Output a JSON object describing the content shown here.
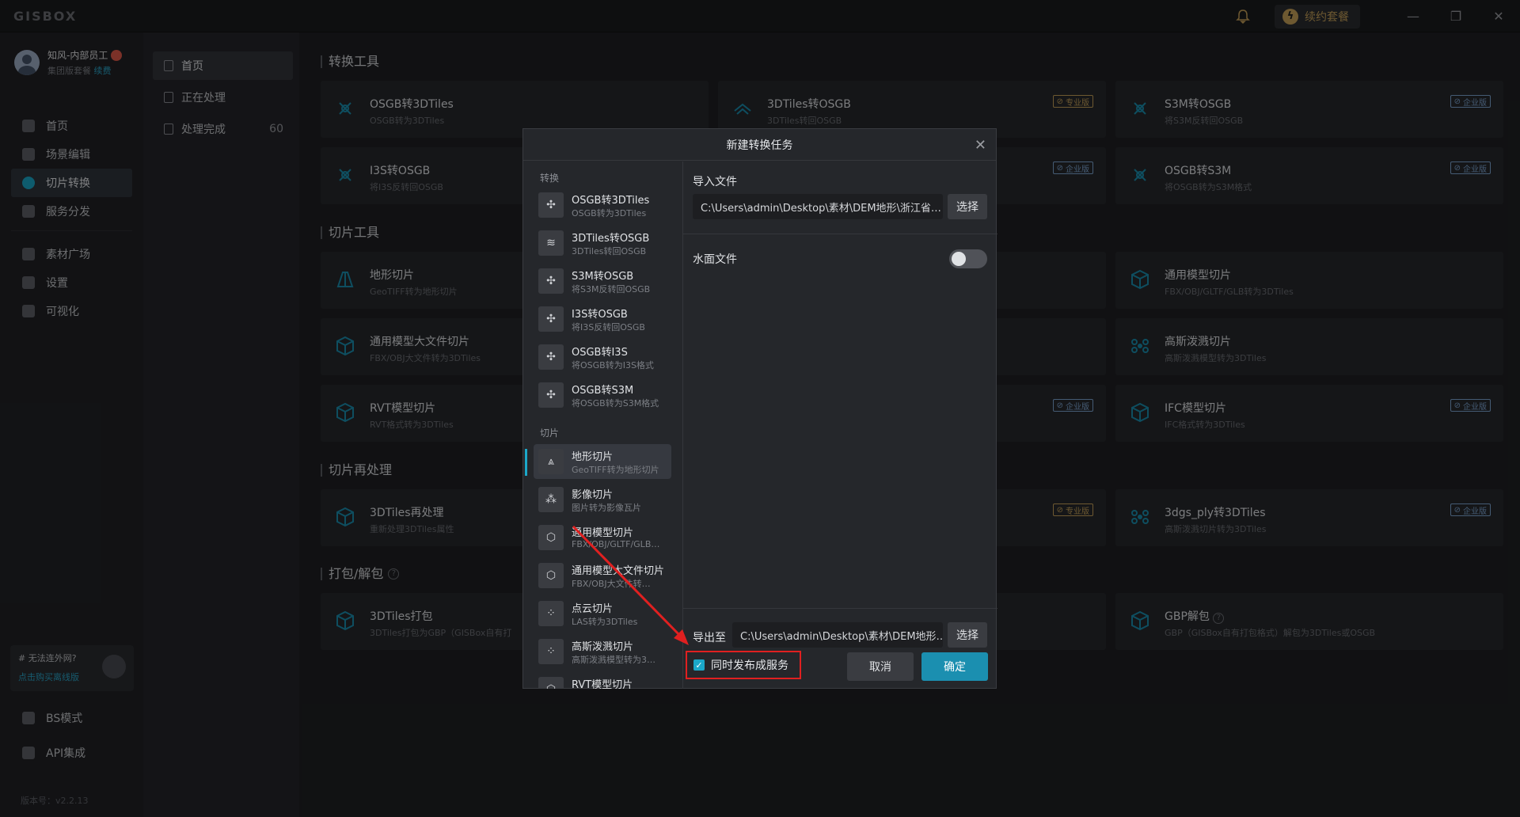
{
  "app": {
    "logo": "GISBOX"
  },
  "titlebar": {
    "renew_label": "续约套餐"
  },
  "user": {
    "name": "知风-内部员工",
    "plan": "集团版套餐",
    "renew_link": "续费"
  },
  "nav": [
    {
      "label": "首页",
      "icon": "home-icon"
    },
    {
      "label": "场景编辑",
      "icon": "cube-icon"
    },
    {
      "label": "切片转换",
      "icon": "convert-icon"
    },
    {
      "label": "服务分发",
      "icon": "upload-icon"
    },
    {
      "label": "素材广场",
      "icon": "chart-icon"
    },
    {
      "label": "设置",
      "icon": "gear-icon"
    },
    {
      "label": "可视化",
      "icon": "visual-icon"
    },
    {
      "label": "BS模式",
      "icon": "code-icon"
    },
    {
      "label": "API集成",
      "icon": "api-icon"
    }
  ],
  "promo": {
    "title": "# 无法连外网?",
    "link": "点击购买离线版"
  },
  "version": "版本号：v2.2.13",
  "subnav": [
    {
      "label": "首页"
    },
    {
      "label": "正在处理"
    },
    {
      "label": "处理完成",
      "count": "60"
    }
  ],
  "sections": {
    "convert": "转换工具",
    "slice": "切片工具",
    "reprocess": "切片再处理",
    "pack": "打包/解包"
  },
  "tags": {
    "pro": "专业版",
    "ent": "企业版"
  },
  "cards": {
    "c1": {
      "title": "OSGB转3DTiles",
      "sub": "OSGB转为3DTiles"
    },
    "c2": {
      "title": "3DTiles转OSGB",
      "sub": "3DTiles转回OSGB"
    },
    "c3": {
      "title": "S3M转OSGB",
      "sub": "将S3M反转回OSGB"
    },
    "c4": {
      "title": "I3S转OSGB",
      "sub": "将I3S反转回OSGB"
    },
    "c6": {
      "title": "OSGB转S3M",
      "sub": "将OSGB转为S3M格式"
    },
    "c7": {
      "title": "地形切片",
      "sub": "GeoTIFF转为地形切片"
    },
    "c9": {
      "title": "通用模型切片",
      "sub": "FBX/OBJ/GLTF/GLB转为3DTiles"
    },
    "c10": {
      "title": "通用模型大文件切片",
      "sub": "FBX/OBJ大文件转为3DTiles"
    },
    "c12": {
      "title": "高斯泼溅切片",
      "sub": "高斯泼溅模型转为3DTiles"
    },
    "c13": {
      "title": "RVT模型切片",
      "sub": "RVT格式转为3DTiles"
    },
    "c15": {
      "title": "IFC模型切片",
      "sub": "IFC格式转为3DTiles"
    },
    "c16": {
      "title": "3DTiles再处理",
      "sub": "重新处理3DTiles属性"
    },
    "c18": {
      "title": "3dgs_ply转3DTiles",
      "sub": "高斯泼溅切片转为3DTiles"
    },
    "c19": {
      "title": "3DTiles打包",
      "sub": "3DTiles打包为GBP（GISBox自有打"
    },
    "c21": {
      "title": "GBP解包",
      "sub": "GBP（GISBox自有打包格式）解包为3DTiles或OSGB"
    }
  },
  "dialog": {
    "title": "新建转换任务",
    "group_convert": "转换",
    "group_slice": "切片",
    "items": [
      {
        "title": "OSGB转3DTiles",
        "sub": "OSGB转为3DTiles"
      },
      {
        "title": "3DTiles转OSGB",
        "sub": "3DTiles转回OSGB"
      },
      {
        "title": "S3M转OSGB",
        "sub": "将S3M反转回OSGB"
      },
      {
        "title": "I3S转OSGB",
        "sub": "将I3S反转回OSGB"
      },
      {
        "title": "OSGB转I3S",
        "sub": "将OSGB转为I3S格式"
      },
      {
        "title": "OSGB转S3M",
        "sub": "将OSGB转为S3M格式"
      },
      {
        "title": "地形切片",
        "sub": "GeoTIFF转为地形切片"
      },
      {
        "title": "影像切片",
        "sub": "图片转为影像瓦片"
      },
      {
        "title": "通用模型切片",
        "sub": "FBX/OBJ/GLTF/GLB…"
      },
      {
        "title": "通用模型大文件切片",
        "sub": "FBX/OBJ大文件转…"
      },
      {
        "title": "点云切片",
        "sub": "LAS转为3DTiles"
      },
      {
        "title": "高斯泼溅切片",
        "sub": "高斯泼溅模型转为3…"
      },
      {
        "title": "RVT模型切片",
        "sub": ""
      }
    ],
    "import_label": "导入文件",
    "import_path": "C:\\Users\\admin\\Desktop\\素材\\DEM地形\\浙江省…",
    "select_label": "选择",
    "water_label": "水面文件",
    "water_enabled": false,
    "export_label": "导出至",
    "export_path": "C:\\Users\\admin\\Desktop\\素材\\DEM地形…",
    "publish_label": "同时发布成服务",
    "publish_checked": true,
    "cancel_label": "取消",
    "ok_label": "确定"
  },
  "colors": {
    "accent": "#1ba8c9",
    "highlight": "#e02020",
    "pro": "#c8a35a",
    "enterprise": "#7fa8d6"
  }
}
